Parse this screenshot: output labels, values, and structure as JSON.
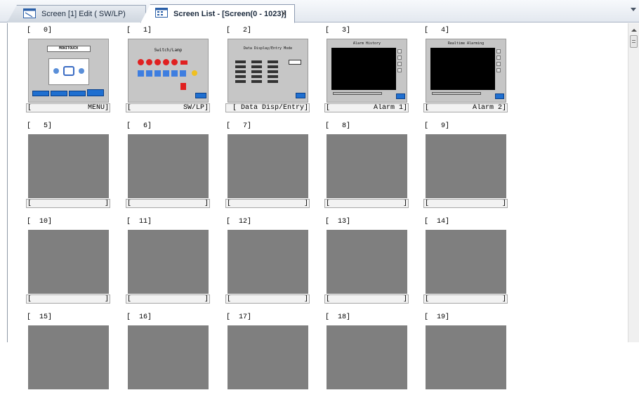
{
  "tabs": [
    {
      "label": "Screen [1] Edit (      SW/LP)",
      "icon": "screen-edit-icon",
      "active": false
    },
    {
      "label": "Screen List - [Screen(0 - 1023)]",
      "icon": "screen-list-icon",
      "active": true,
      "close": "×"
    }
  ],
  "screens": [
    {
      "num": "[   0]",
      "name": "MENU]",
      "left_br": "[",
      "kind": "menu",
      "title": "MONITOUCH"
    },
    {
      "num": "[   1]",
      "name": "SW/LP]",
      "left_br": "[",
      "kind": "switch",
      "title": "Switch/Lamp"
    },
    {
      "num": "[   2]",
      "name": "[ Data Disp/Entry]",
      "left_br": "",
      "kind": "data",
      "title": "Data Display/Entry Mode"
    },
    {
      "num": "[   3]",
      "name": "Alarm 1]",
      "left_br": "[",
      "kind": "alarm",
      "title": "Alarm History"
    },
    {
      "num": "[   4]",
      "name": "Alarm 2]",
      "left_br": "[",
      "kind": "alarm",
      "title": "Realtime Alarming"
    },
    {
      "num": "[   5]",
      "name": "]",
      "left_br": "[",
      "kind": "empty"
    },
    {
      "num": "[   6]",
      "name": "]",
      "left_br": "[",
      "kind": "empty"
    },
    {
      "num": "[   7]",
      "name": "]",
      "left_br": "[",
      "kind": "empty"
    },
    {
      "num": "[   8]",
      "name": "]",
      "left_br": "[",
      "kind": "empty"
    },
    {
      "num": "[   9]",
      "name": "]",
      "left_br": "[",
      "kind": "empty"
    },
    {
      "num": "[  10]",
      "name": "]",
      "left_br": "[",
      "kind": "empty"
    },
    {
      "num": "[  11]",
      "name": "]",
      "left_br": "[",
      "kind": "empty"
    },
    {
      "num": "[  12]",
      "name": "]",
      "left_br": "[",
      "kind": "empty"
    },
    {
      "num": "[  13]",
      "name": "]",
      "left_br": "[",
      "kind": "empty"
    },
    {
      "num": "[  14]",
      "name": "]",
      "left_br": "[",
      "kind": "empty"
    },
    {
      "num": "[  15]",
      "name": "",
      "left_br": "",
      "kind": "empty"
    },
    {
      "num": "[  16]",
      "name": "",
      "left_br": "",
      "kind": "empty"
    },
    {
      "num": "[  17]",
      "name": "",
      "left_br": "",
      "kind": "empty"
    },
    {
      "num": "[  18]",
      "name": "",
      "left_br": "",
      "kind": "empty"
    },
    {
      "num": "[  19]",
      "name": "",
      "left_br": "",
      "kind": "empty"
    }
  ],
  "colors": {
    "empty_thumb": "#7f7f7f",
    "screen_bg": "#c6c6c6",
    "button_blue": "#1f6fd0",
    "lamp_red": "#e02020"
  }
}
